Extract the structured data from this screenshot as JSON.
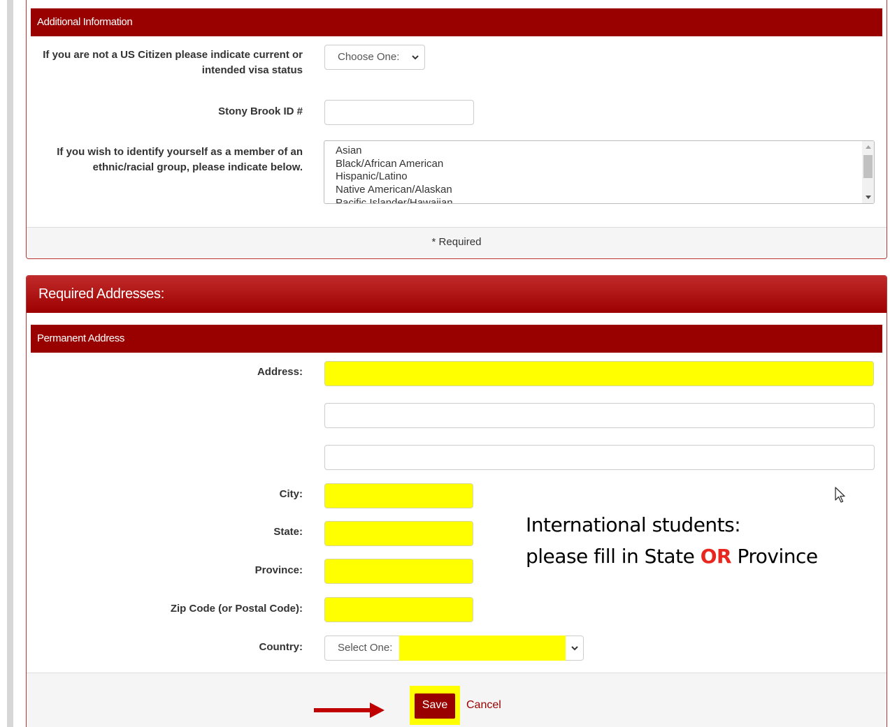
{
  "additional_info": {
    "heading": "Additional Information",
    "visa_label": "If you are not a US Citizen please indicate current or intended visa status",
    "visa_value": "Choose One:",
    "sbu_id_label": "Stony Brook ID #",
    "ethnic_label": "If you wish to identify yourself as a member of an ethnic/racial group, please indicate below.",
    "ethnic_options": [
      "Asian",
      "Black/African American",
      "Hispanic/Latino",
      "Native American/Alaskan",
      "Pacific Islander/Hawaiian"
    ],
    "required_note": "* Required"
  },
  "addresses": {
    "heading": "Required Addresses:",
    "permanent_heading": "Permanent Address",
    "address_label": "Address:",
    "city_label": "City:",
    "state_label": "State:",
    "province_label": "Province:",
    "zip_label": "Zip Code (or Postal Code):",
    "country_label": "Country:",
    "country_value": "Select One:"
  },
  "callout": {
    "line1": "International students:",
    "line2_prefix": "please fill in State ",
    "line2_emph": "OR",
    "line2_suffix": " Province"
  },
  "actions": {
    "save_label": "Save",
    "cancel_label": "Cancel"
  },
  "colors": {
    "brand_red": "#990000",
    "highlight_yellow": "#ffff00",
    "callout_red": "#e8281e"
  }
}
